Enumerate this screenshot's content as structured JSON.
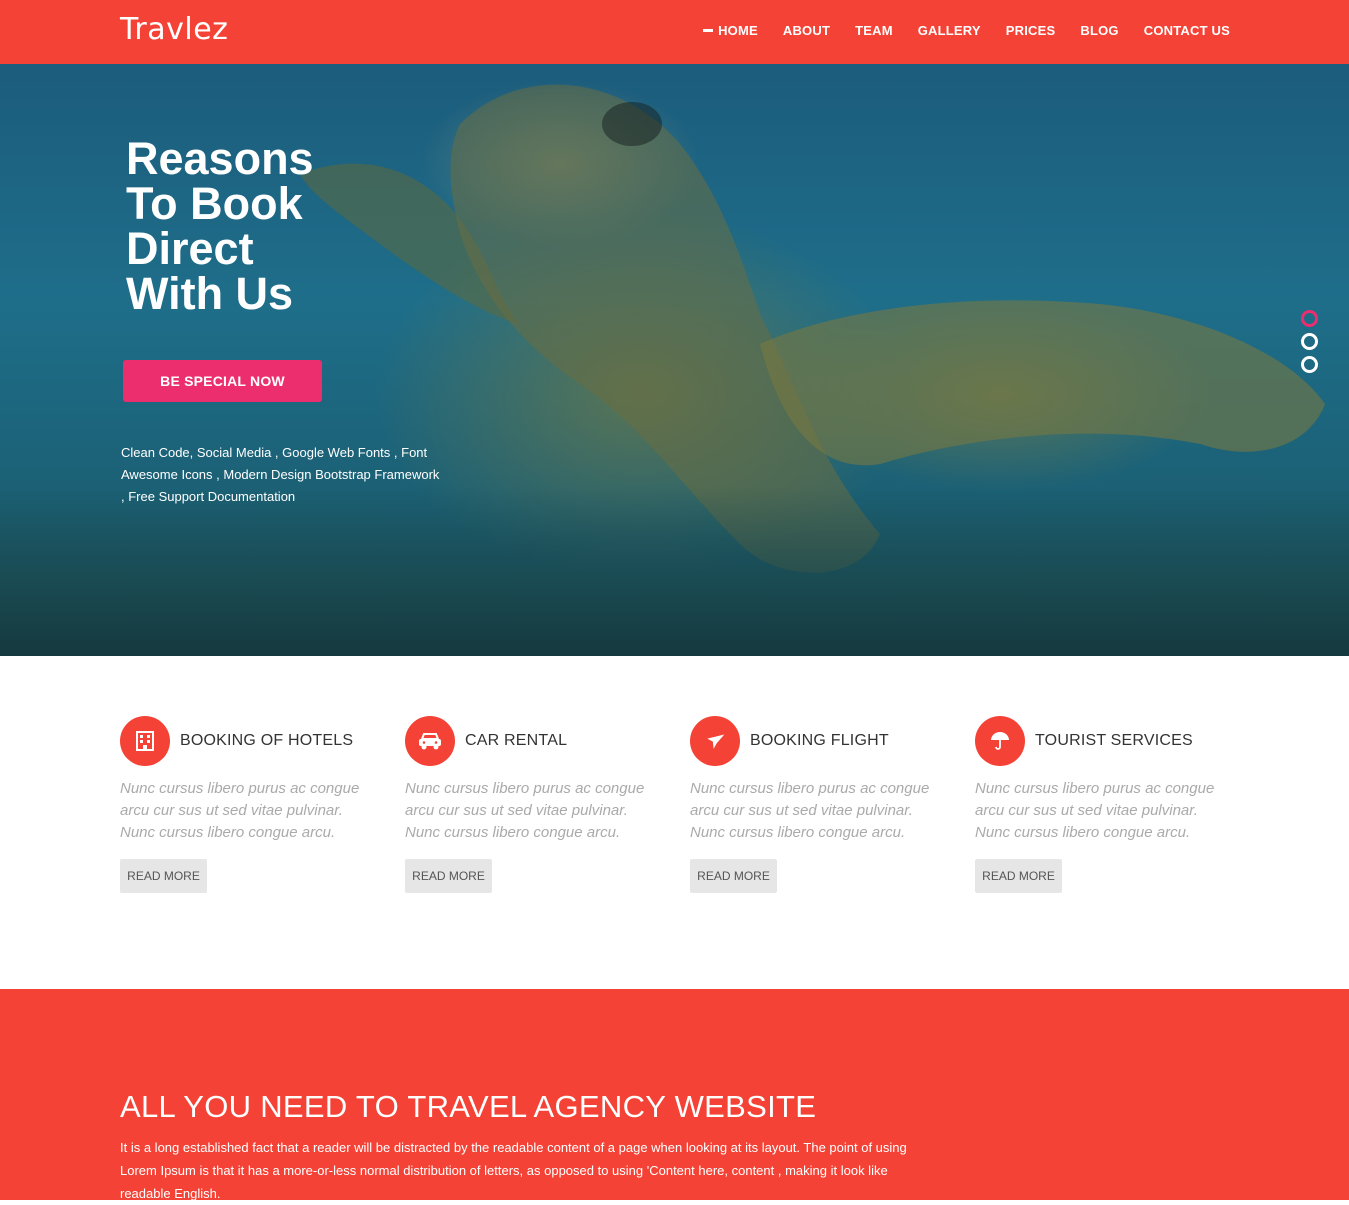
{
  "brand": {
    "logo": "Travlez"
  },
  "nav": [
    {
      "label": "HOME",
      "active": true
    },
    {
      "label": "ABOUT"
    },
    {
      "label": "TEAM"
    },
    {
      "label": "GALLERY"
    },
    {
      "label": "PRICES"
    },
    {
      "label": "BLOG"
    },
    {
      "label": "CONTACT US"
    }
  ],
  "hero": {
    "title_lines": [
      "Reasons",
      "To Book",
      "Direct",
      "With Us"
    ],
    "cta": "BE SPECIAL NOW",
    "description": "Clean Code, Social Media , Google Web Fonts , Font Awesome Icons , Modern Design Bootstrap Framework , Free Support Documentation",
    "slides": 3,
    "active_slide": 1
  },
  "services": [
    {
      "icon": "hotel-icon",
      "title": "BOOKING OF HOTELS",
      "text": "Nunc cursus libero purus ac congue arcu cur sus ut sed vitae pulvinar. Nunc cursus libero congue arcu.",
      "button": "READ MORE"
    },
    {
      "icon": "car-icon",
      "title": "CAR RENTAL",
      "text": "Nunc cursus libero purus ac congue arcu cur sus ut sed vitae pulvinar. Nunc cursus libero congue arcu.",
      "button": "READ MORE"
    },
    {
      "icon": "plane-icon",
      "title": "BOOKING FLIGHT",
      "text": "Nunc cursus libero purus ac congue arcu cur sus ut sed vitae pulvinar. Nunc cursus libero congue arcu.",
      "button": "READ MORE"
    },
    {
      "icon": "umbrella-icon",
      "title": "TOURIST SERVICES",
      "text": "Nunc cursus libero purus ac congue arcu cur sus ut sed vitae pulvinar. Nunc cursus libero congue arcu.",
      "button": "READ MORE"
    }
  ],
  "about": {
    "title": "ALL YOU NEED TO TRAVEL AGENCY WEBSITE",
    "text": "It is a long established fact that a reader will be distracted by the readable content of a page when looking at its layout. The point of using Lorem Ipsum is that it has a more-or-less normal distribution of letters, as opposed to using 'Content here, content , making it look like readable English."
  },
  "colors": {
    "primary": "#f44336",
    "accent": "#ec2e6f",
    "button_grey": "#e6e6e6"
  }
}
